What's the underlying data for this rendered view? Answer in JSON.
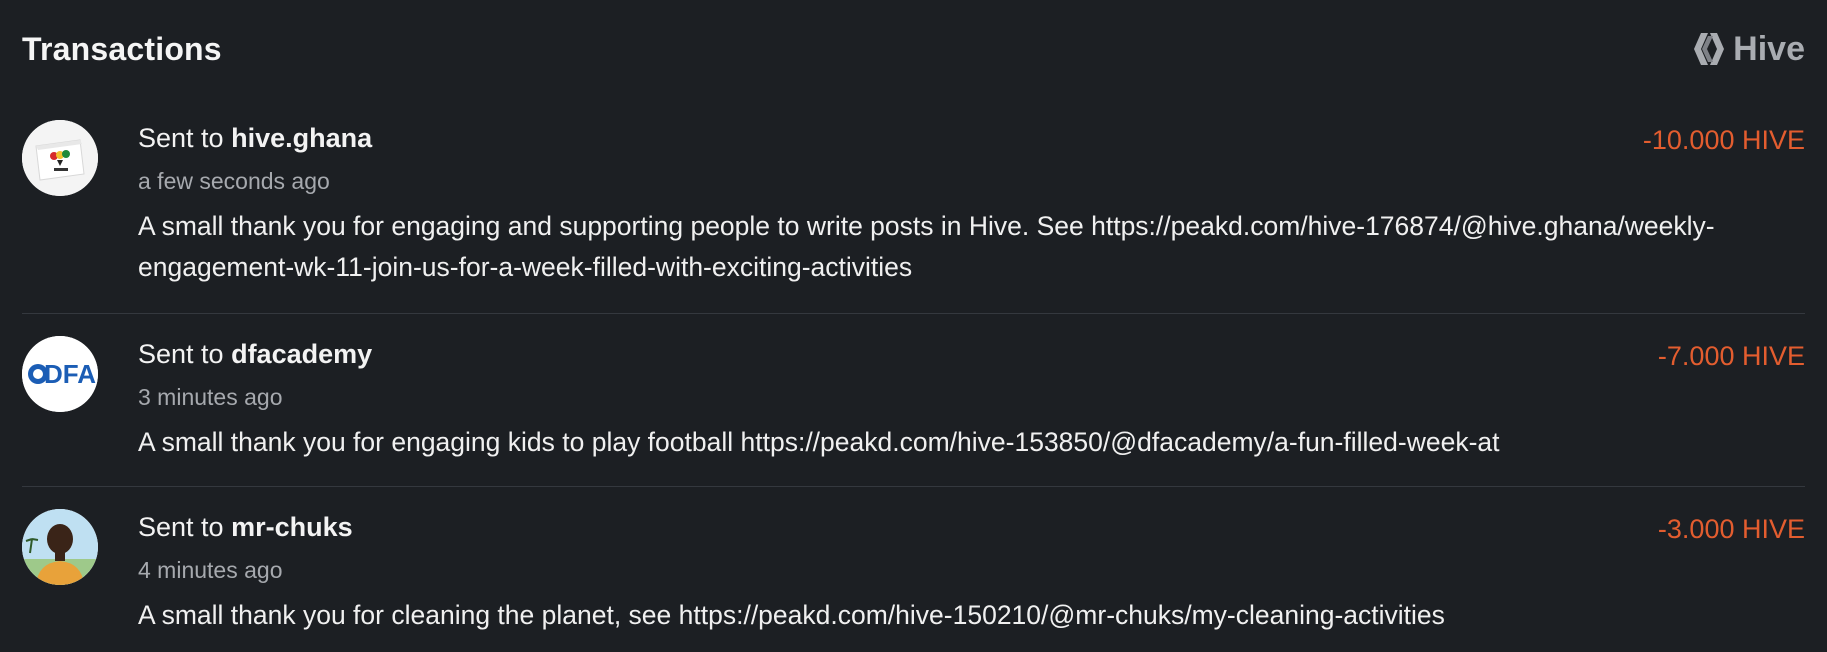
{
  "header": {
    "title": "Transactions",
    "brand_label": "Hive",
    "brand_icon": "hive-logo-icon"
  },
  "colors": {
    "background": "#1c1f23",
    "amount_negative": "#e35d2f",
    "muted_text": "#a6a9ae",
    "divider": "#34383e"
  },
  "transactions": [
    {
      "sent_prefix": "Sent to",
      "recipient": "hive.ghana",
      "time": "a few seconds ago",
      "amount": "-10.000 HIVE",
      "memo": "A small thank you for engaging and supporting people to write posts in Hive. See https://peakd.com/hive-176874/@hive.ghana/weekly-engagement-wk-11-join-us-for-a-week-filled-with-exciting-activities",
      "avatar_icon": "hive-ghana-avatar"
    },
    {
      "sent_prefix": "Sent to",
      "recipient": "dfacademy",
      "time": "3 minutes ago",
      "amount": "-7.000 HIVE",
      "memo": "A small thank you for engaging kids to play football https://peakd.com/hive-153850/@dfacademy/a-fun-filled-week-at",
      "avatar_icon": "dfa-logo-avatar",
      "avatar_text": "DFA"
    },
    {
      "sent_prefix": "Sent to",
      "recipient": "mr-chuks",
      "time": "4 minutes ago",
      "amount": "-3.000 HIVE",
      "memo": "A small thank you for cleaning the planet, see https://peakd.com/hive-150210/@mr-chuks/my-cleaning-activities",
      "avatar_icon": "user-photo-avatar"
    }
  ]
}
